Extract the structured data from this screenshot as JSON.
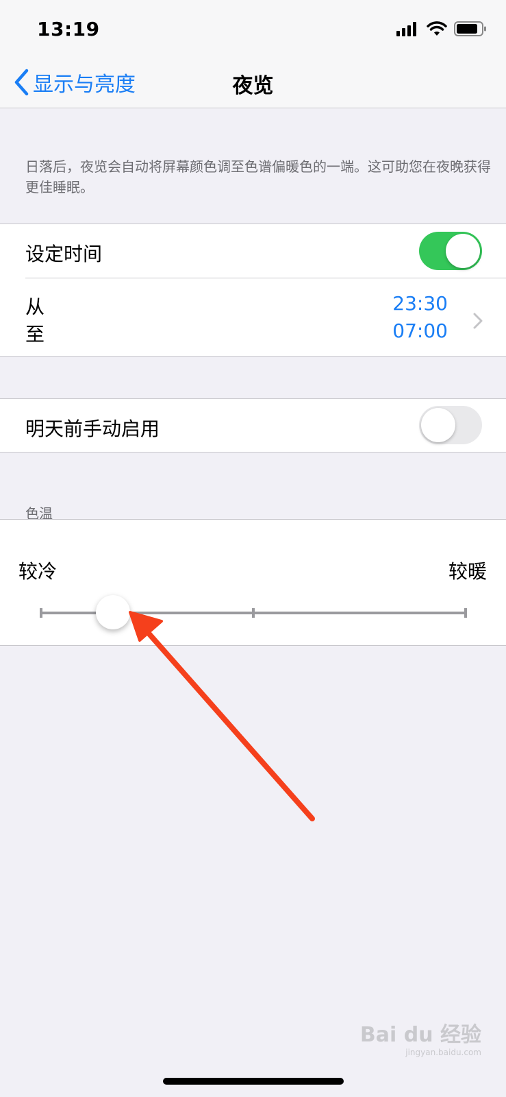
{
  "status_bar": {
    "time": "13:19",
    "icons": [
      "signal-icon",
      "wifi-icon",
      "battery-icon"
    ]
  },
  "nav": {
    "back_label": "显示与亮度",
    "title": "夜览"
  },
  "description": "日落后，夜览会自动将屏幕颜色调至色谱偏暖色的一端。这可助您在夜晚获得更佳睡眠。",
  "schedule": {
    "label": "设定时间",
    "enabled": true,
    "from_label": "从",
    "to_label": "至",
    "from_time": "23:30",
    "to_time": "07:00"
  },
  "manual": {
    "label": "明天前手动启用",
    "enabled": false
  },
  "color_temp": {
    "section_title": "色温",
    "cooler_label": "较冷",
    "warmer_label": "较暖",
    "value_fraction": 0.17
  },
  "watermark": {
    "brand": "Bai du 经验",
    "sub": "jingyan.baidu.com"
  },
  "colors": {
    "accent": "#1a7ef5",
    "toggle_on": "#34c759",
    "arrow": "#f5401c"
  }
}
